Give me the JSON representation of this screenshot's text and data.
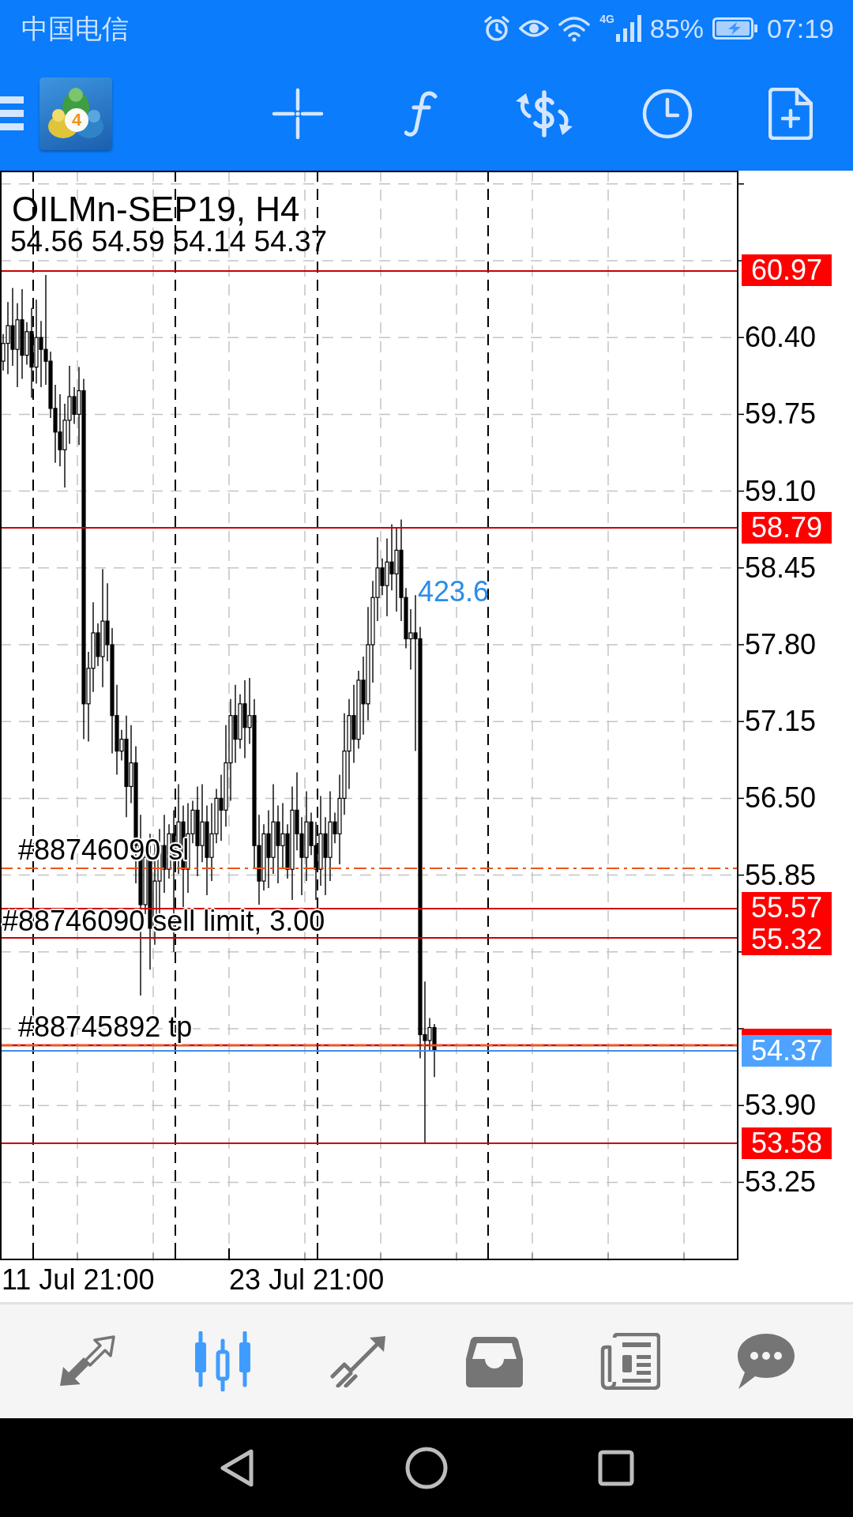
{
  "status_bar": {
    "carrier": "中国电信",
    "network": "4G",
    "battery": "85%",
    "time": "07:19"
  },
  "toolbar": {
    "logo_badge": "4"
  },
  "chart": {
    "symbol": "OILMn-SEP19, H4",
    "ohlc": "54.56 54.59 54.14 54.37",
    "price_scale": [
      "60.40",
      "59.75",
      "59.10",
      "58.45",
      "57.80",
      "57.15",
      "56.50",
      "55.85",
      "53.90",
      "53.25"
    ],
    "levels": [
      {
        "kind": "order",
        "tag": "60.97"
      },
      {
        "kind": "order",
        "tag": "58.79"
      },
      {
        "kind": "stop_loss",
        "label": "#88746090 sl"
      },
      {
        "kind": "order",
        "tag": "55.57"
      },
      {
        "kind": "order",
        "tag": "55.32",
        "label": "#88746090 sell limit, 3.00"
      },
      {
        "kind": "take_profit",
        "label": "#88745892 tp"
      },
      {
        "kind": "bid",
        "tag": "54.37"
      },
      {
        "kind": "order",
        "tag": "53.58"
      }
    ],
    "annotation": "423.6",
    "time_scale": [
      "11 Jul 21:00",
      "23 Jul 21:00"
    ]
  },
  "bottom_tabs": [
    {
      "selected": false
    },
    {
      "selected": true
    },
    {
      "selected": false
    },
    {
      "selected": false
    },
    {
      "selected": false
    },
    {
      "selected": false
    }
  ]
}
